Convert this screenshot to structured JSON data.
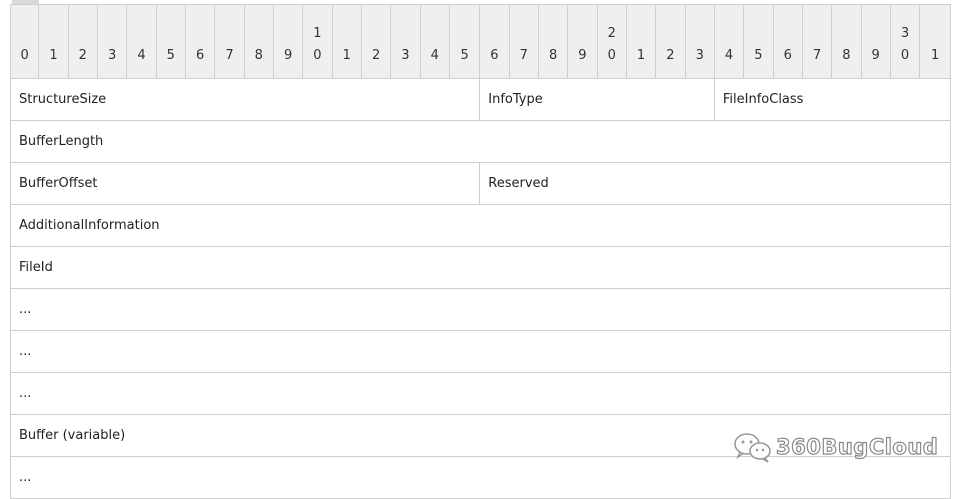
{
  "header_bits": [
    {
      "top": "",
      "bottom": "0"
    },
    {
      "top": "",
      "bottom": "1"
    },
    {
      "top": "",
      "bottom": "2"
    },
    {
      "top": "",
      "bottom": "3"
    },
    {
      "top": "",
      "bottom": "4"
    },
    {
      "top": "",
      "bottom": "5"
    },
    {
      "top": "",
      "bottom": "6"
    },
    {
      "top": "",
      "bottom": "7"
    },
    {
      "top": "",
      "bottom": "8"
    },
    {
      "top": "",
      "bottom": "9"
    },
    {
      "top": "1",
      "bottom": "0"
    },
    {
      "top": "",
      "bottom": "1"
    },
    {
      "top": "",
      "bottom": "2"
    },
    {
      "top": "",
      "bottom": "3"
    },
    {
      "top": "",
      "bottom": "4"
    },
    {
      "top": "",
      "bottom": "5"
    },
    {
      "top": "",
      "bottom": "6"
    },
    {
      "top": "",
      "bottom": "7"
    },
    {
      "top": "",
      "bottom": "8"
    },
    {
      "top": "",
      "bottom": "9"
    },
    {
      "top": "2",
      "bottom": "0"
    },
    {
      "top": "",
      "bottom": "1"
    },
    {
      "top": "",
      "bottom": "2"
    },
    {
      "top": "",
      "bottom": "3"
    },
    {
      "top": "",
      "bottom": "4"
    },
    {
      "top": "",
      "bottom": "5"
    },
    {
      "top": "",
      "bottom": "6"
    },
    {
      "top": "",
      "bottom": "7"
    },
    {
      "top": "",
      "bottom": "8"
    },
    {
      "top": "",
      "bottom": "9"
    },
    {
      "top": "3",
      "bottom": "0"
    },
    {
      "top": "",
      "bottom": "1"
    }
  ],
  "rows": [
    [
      {
        "label": "StructureSize",
        "span": 16
      },
      {
        "label": "InfoType",
        "span": 8
      },
      {
        "label": "FileInfoClass",
        "span": 8
      }
    ],
    [
      {
        "label": "BufferLength",
        "span": 32
      }
    ],
    [
      {
        "label": "BufferOffset",
        "span": 16
      },
      {
        "label": "Reserved",
        "span": 16
      }
    ],
    [
      {
        "label": "AdditionalInformation",
        "span": 32
      }
    ],
    [
      {
        "label": "FileId",
        "span": 32
      }
    ],
    [
      {
        "label": "...",
        "span": 32
      }
    ],
    [
      {
        "label": "...",
        "span": 32
      }
    ],
    [
      {
        "label": "...",
        "span": 32
      }
    ],
    [
      {
        "label": "Buffer (variable)",
        "span": 32
      }
    ],
    [
      {
        "label": "...",
        "span": 32
      }
    ]
  ],
  "watermark": {
    "text": "360BugCloud",
    "icon": "wechat-icon"
  }
}
